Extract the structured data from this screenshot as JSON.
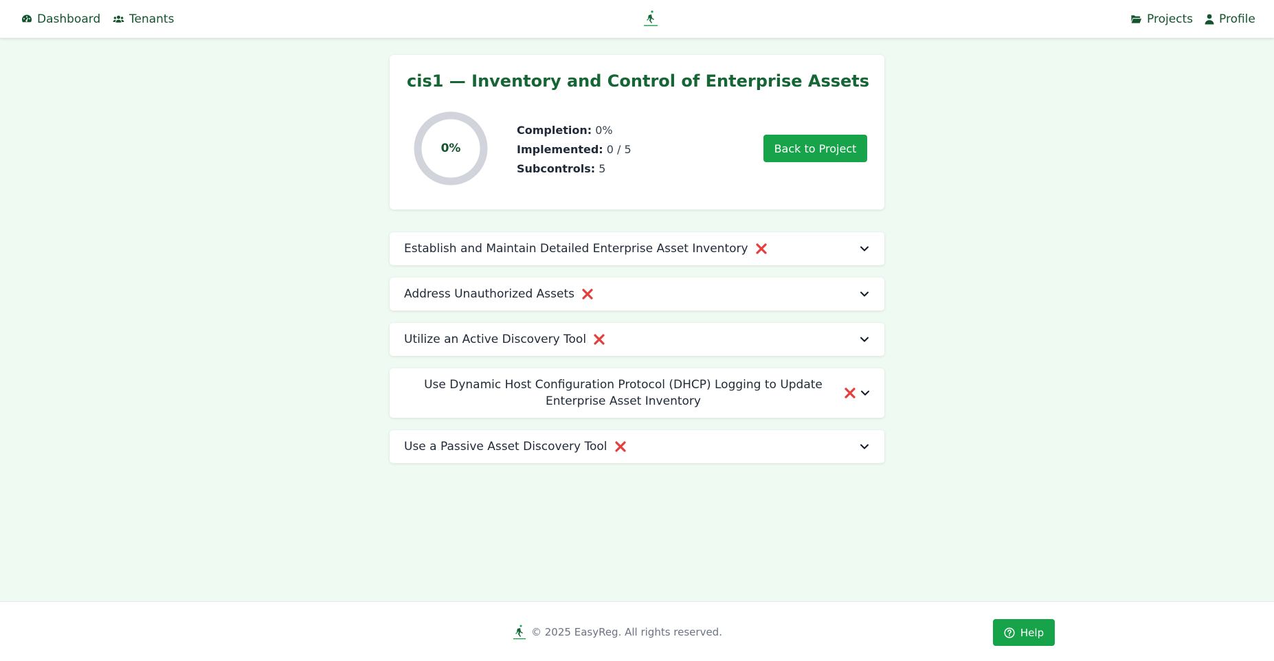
{
  "nav": {
    "dashboard_label": "Dashboard",
    "tenants_label": "Tenants",
    "projects_label": "Projects",
    "profile_label": "Profile",
    "logo_text": "EASYREG"
  },
  "control": {
    "title": "cis1 — Inventory and Control of Enterprise Assets",
    "progress_percent": 0,
    "progress_label": "0%",
    "completion_key": "Completion:",
    "completion_value": "0%",
    "implemented_key": "Implemented:",
    "implemented_value": "0 / 5",
    "subcontrols_key": "Subcontrols:",
    "subcontrols_value": "5",
    "back_button_label": "Back to Project"
  },
  "subcontrols": [
    {
      "label": "Establish and Maintain Detailed Enterprise Asset Inventory",
      "status_icon": "x-icon",
      "status": "not implemented"
    },
    {
      "label": "Address Unauthorized Assets",
      "status_icon": "x-icon",
      "status": "not implemented"
    },
    {
      "label": "Utilize an Active Discovery Tool",
      "status_icon": "x-icon",
      "status": "not implemented"
    },
    {
      "label": "Use Dynamic Host Configuration Protocol (DHCP) Logging to Update Enterprise Asset Inventory",
      "status_icon": "x-icon",
      "status": "not implemented"
    },
    {
      "label": "Use a Passive Asset Discovery Tool",
      "status_icon": "x-icon",
      "status": "not implemented"
    }
  ],
  "footer": {
    "copyright": "© 2025 EasyReg. All rights reserved.",
    "help_label": "Help"
  },
  "colors": {
    "brand_dark": "#166534",
    "accent": "#16a34a",
    "background": "#effbf2",
    "status_x": "#e53e3e"
  }
}
